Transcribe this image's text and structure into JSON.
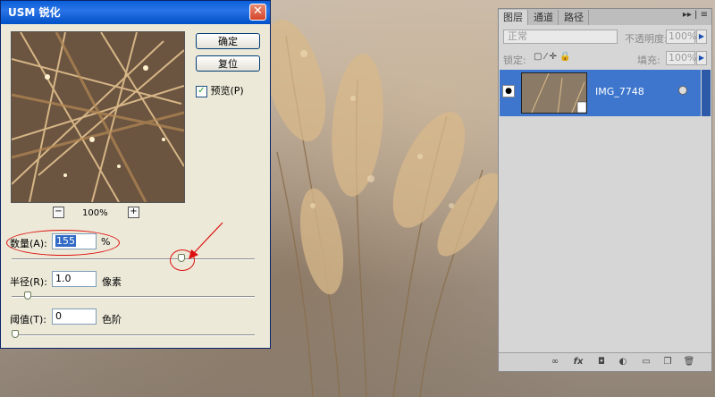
{
  "dialog": {
    "title": "USM 锐化",
    "close_glyph": "✕",
    "ok_label": "确定",
    "reset_label": "复位",
    "preview_label": "预览(P)",
    "preview_checked": true,
    "zoom_out_glyph": "−",
    "zoom_in_glyph": "+",
    "zoom_level": "100%",
    "amount_label": "数量(A):",
    "amount_value": "155",
    "amount_unit": "%",
    "amount_level": 155,
    "radius_label": "半径(R):",
    "radius_value": "1.0",
    "radius_unit": "像素",
    "threshold_label": "阈值(T):",
    "threshold_value": "0",
    "threshold_unit": "色阶"
  },
  "layers_panel": {
    "tabs": [
      "图层",
      "通道",
      "路径"
    ],
    "menu_glyph": "▸▸ | ≡",
    "blend_mode": "正常",
    "opacity_label": "不透明度:",
    "opacity_value": "100%",
    "lock_label": "锁定:",
    "fill_label": "填充:",
    "fill_value": "100%",
    "layer": {
      "name": "IMG_7748"
    },
    "bottom_icons": [
      "link-icon",
      "fx-icon",
      "mask-icon",
      "adjustment-icon",
      "group-icon",
      "new-layer-icon",
      "trash-icon"
    ]
  },
  "colors": {
    "titlebar": "#0a5fd8",
    "dialog_bg": "#ece9d8",
    "selection": "#3d76cc",
    "annotation": "#dd1111"
  }
}
